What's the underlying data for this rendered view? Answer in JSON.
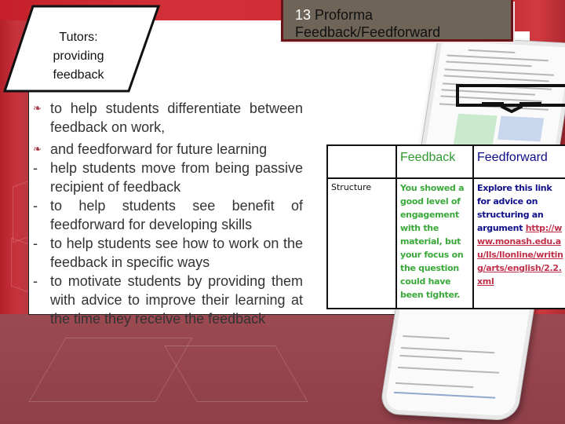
{
  "slide": {
    "title_number": "13",
    "title_text": "Proforma Feedback/Feedforward",
    "side_label": "Tutors: providing feedback",
    "side_label_lines": [
      "Tutors:",
      "providing",
      "feedback"
    ]
  },
  "bullets": [
    {
      "marker": "leaf-bullet-icon",
      "text": "to help students differentiate between feedback on work,"
    },
    {
      "marker": "leaf-bullet-icon",
      "text": "and feedforward for future learning"
    },
    {
      "marker": "-",
      "text": "help students move from being passive recipient of feedback"
    },
    {
      "marker": "-",
      "text": "to help students see benefit of feedforward for developing skills"
    },
    {
      "marker": "-",
      "text": "to help students see how to work on the feedback in specific ways"
    },
    {
      "marker": "-",
      "text": "to motivate students by providing them with advice to improve their learning at the time they receive the feedback"
    }
  ],
  "table": {
    "headers": [
      "",
      "Feedback",
      "Feedforward"
    ],
    "rows": [
      {
        "label": "Structure",
        "feedback": "You showed a good level of engagement with the material, but your focus on the question could have been tighter.",
        "feedforward_text": "Explore this link for advice on structuring an argument",
        "feedforward_link": "http://www.monash.edu.au/lls/llonline/writing/arts/english/2.2.xml"
      }
    ]
  },
  "colors": {
    "feedback_green": "#2f9a2f",
    "feedforward_blue": "#0d0d8a",
    "link_red": "#c0304a",
    "title_box": "#6e6558",
    "background_red": "#b3202a"
  }
}
